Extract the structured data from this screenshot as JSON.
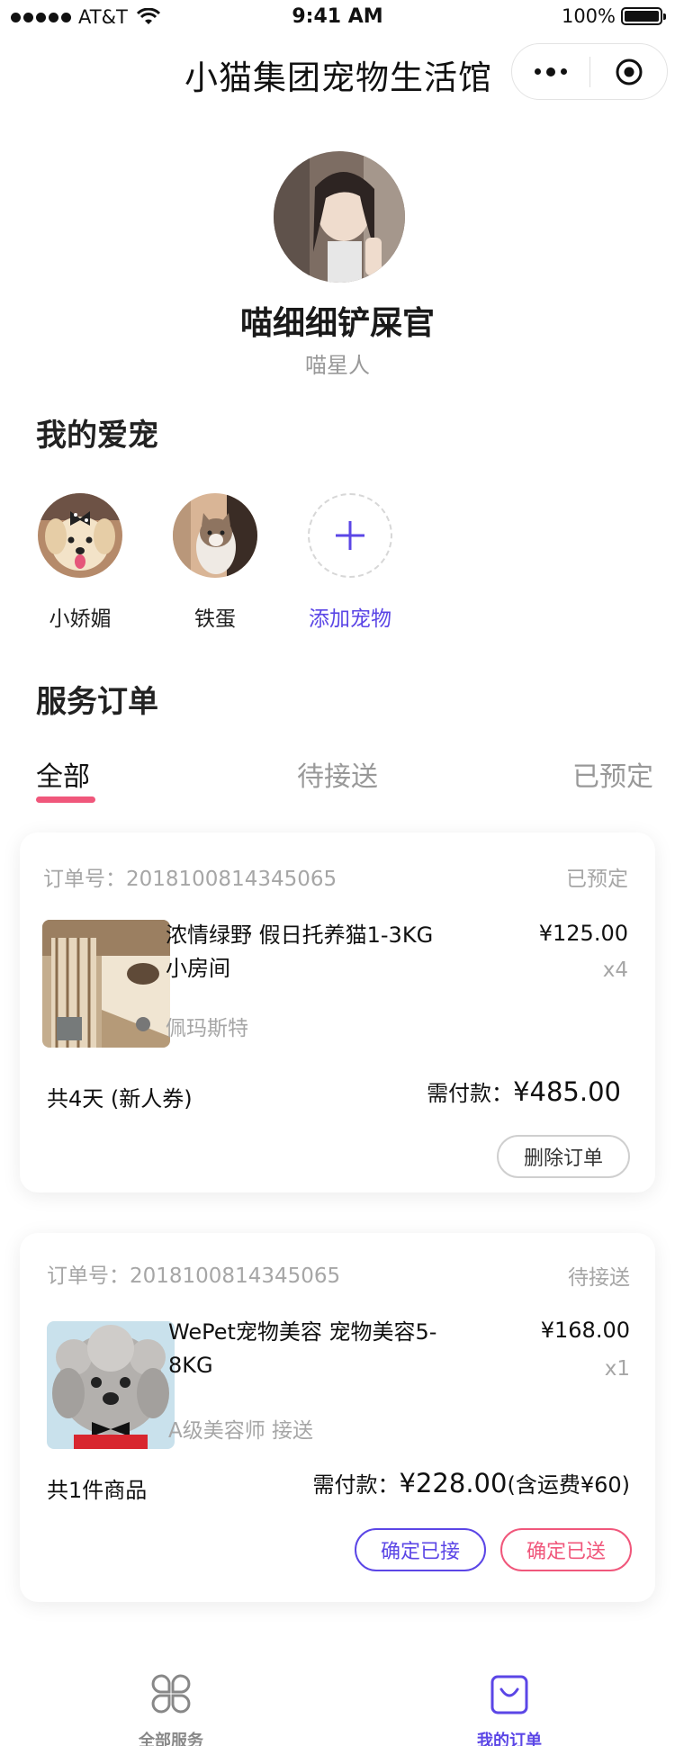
{
  "status_bar": {
    "carrier": "AT&T",
    "time": "9:41 AM",
    "battery": "100%"
  },
  "nav": {
    "title": "小猫集团宠物生活馆"
  },
  "profile": {
    "name": "喵细细铲屎官",
    "tag": "喵星人"
  },
  "pets": {
    "title": "我的爱宠",
    "items": [
      {
        "name": "小娇媚"
      },
      {
        "name": "铁蛋"
      }
    ],
    "add_label": "添加宠物"
  },
  "orders": {
    "title": "服务订单",
    "tabs": [
      {
        "label": "全部"
      },
      {
        "label": "待接送"
      },
      {
        "label": "已预定"
      }
    ],
    "list": [
      {
        "order_no": "订单号：2018100814345065",
        "status": "已预定",
        "product_title": "浓情绿野 假日托养猫1-3KG小房间",
        "product_sub": "佩玛斯特",
        "price": "¥125.00",
        "qty": "x4",
        "summary": "共4天 (新人券)",
        "total_label": "需付款：",
        "total_amount": "¥485.00",
        "total_note": "",
        "buttons": [
          {
            "label": "删除订单"
          }
        ]
      },
      {
        "order_no": "订单号：2018100814345065",
        "status": "待接送",
        "product_title": "WePet宠物美容 宠物美容5-8KG",
        "product_sub": "A级美容师  接送",
        "price": "¥168.00",
        "qty": "x1",
        "summary": "共1件商品",
        "total_label": "需付款：",
        "total_amount": "¥228.00",
        "total_note": "(含运费¥60)",
        "buttons": [
          {
            "label": "确定已接"
          },
          {
            "label": "确定已送"
          }
        ]
      }
    ]
  },
  "bottom_tabs": [
    {
      "label": "全部服务"
    },
    {
      "label": "我的订单"
    }
  ],
  "colors": {
    "accent": "#5b46e6",
    "pink": "#f0577b",
    "muted": "#a6a6a6"
  }
}
